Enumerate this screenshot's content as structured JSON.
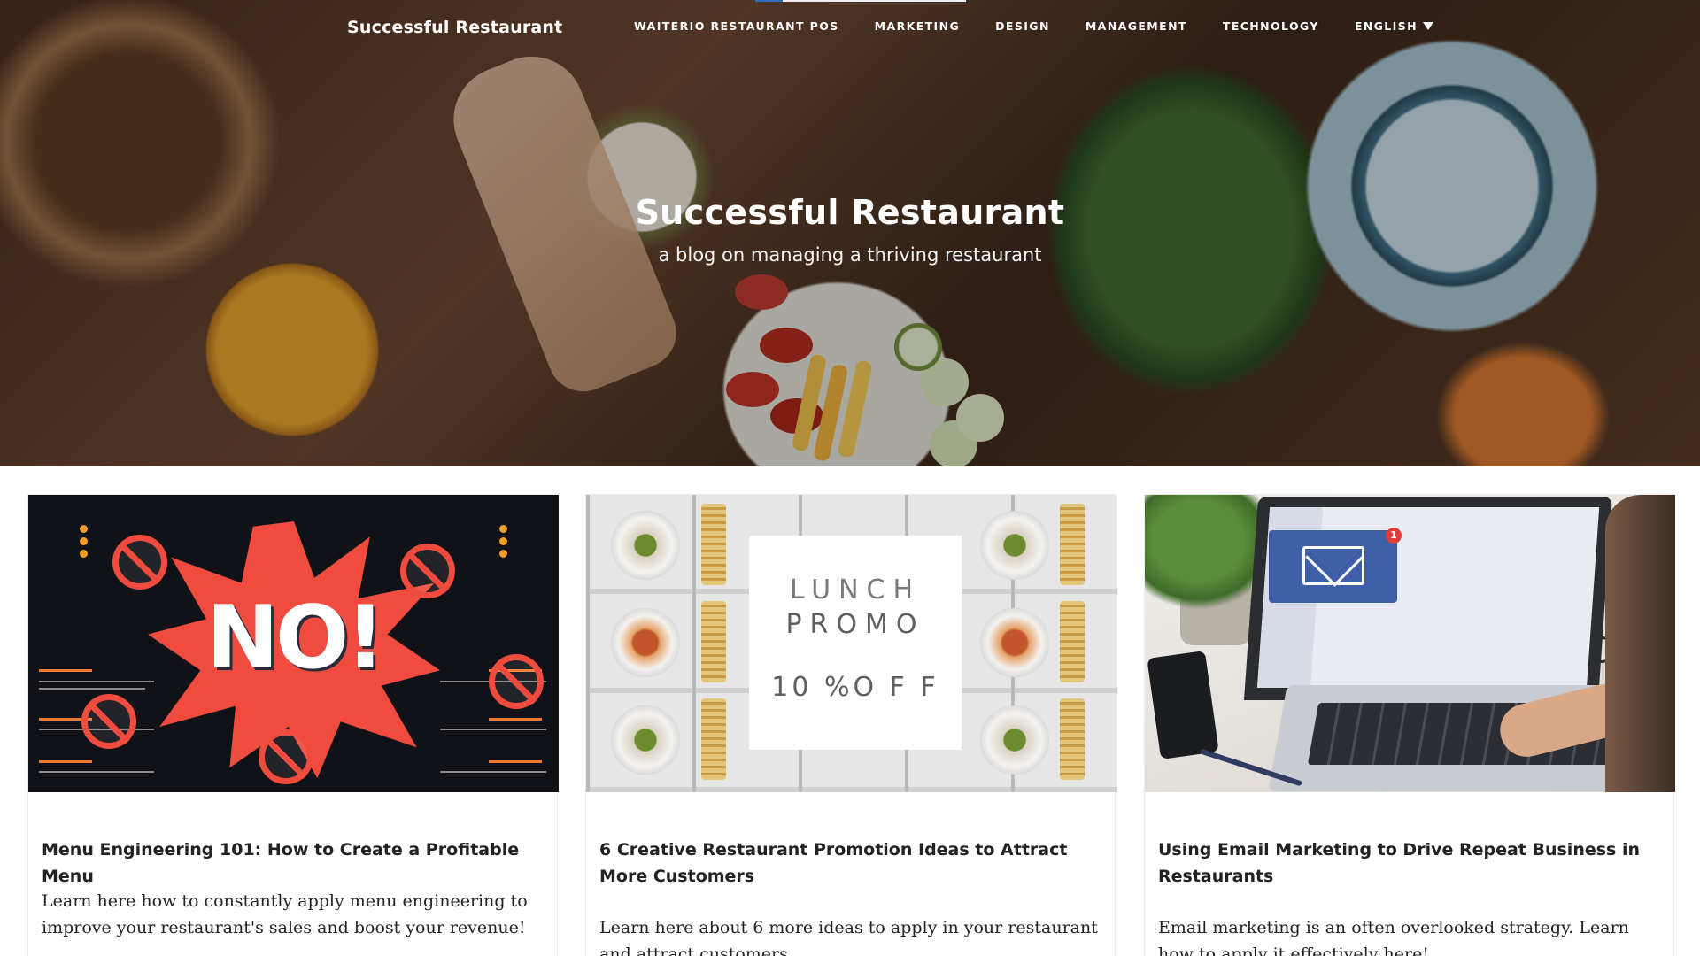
{
  "nav": {
    "brand": "Successful Restaurant",
    "items": [
      {
        "label": "WAITERIO RESTAURANT POS"
      },
      {
        "label": "MARKETING"
      },
      {
        "label": "DESIGN"
      },
      {
        "label": "MANAGEMENT"
      },
      {
        "label": "TECHNOLOGY"
      },
      {
        "label": "ENGLISH",
        "icon": "caret-down-icon"
      }
    ]
  },
  "hero": {
    "title": "Successful Restaurant",
    "subtitle": "a blog on managing a thriving restaurant"
  },
  "scroll_progress": 0.13,
  "cards": [
    {
      "title": "Menu Engineering 101: How to Create a Profitable Menu",
      "excerpt": "Learn here how to constantly apply menu engineering to improve your restaurant's sales and boost your revenue!",
      "image_text": "NO!"
    },
    {
      "title": "6 Creative Restaurant Promotion Ideas to Attract More Customers",
      "excerpt": "Learn here about 6 more ideas to apply in your restaurant and attract customers.",
      "image_text": {
        "line1": "LUNCH",
        "line2": "PROMO",
        "line3": "10 %O F F"
      }
    },
    {
      "title": "Using Email Marketing to Drive Repeat Business in Restaurants",
      "excerpt": "Email marketing is an often overlooked strategy. Learn how to apply it effectively here!",
      "image_text": "1"
    }
  ],
  "colors": {
    "accent": "#2f6fbf",
    "burst": "#ef4b3f",
    "email_blue": "#3f5ea8"
  }
}
